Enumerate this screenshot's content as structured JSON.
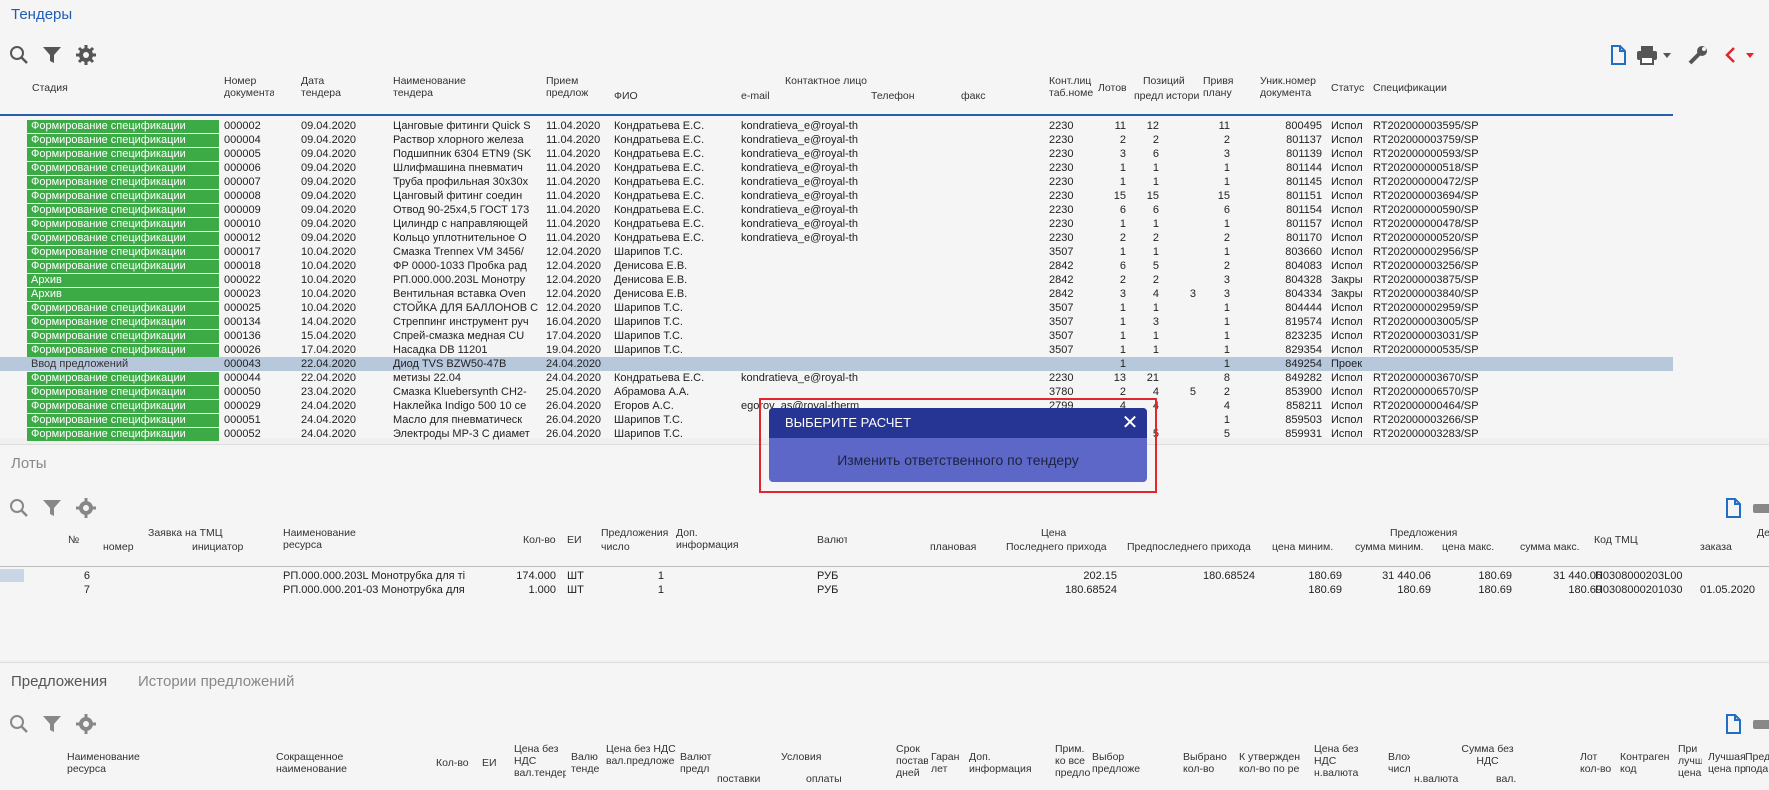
{
  "tenders": {
    "title": "Тендеры",
    "columns": {
      "stage": "Стадия",
      "doc_no": "Номер документа",
      "date": "Дата тендера",
      "name": "Наименование тендера",
      "accept": "Прием предлож",
      "contact": "Контактное лицо",
      "fio": "ФИО",
      "email": "e-mail",
      "phone": "Телефон",
      "fax": "факс",
      "cont_tab": "Конт.лиц таб.номе",
      "lots": "Лотов",
      "positions": "Позиций",
      "pos_sub1": "предл",
      "pos_sub2": "истори",
      "plan": "Привя плану",
      "uniq": "Уник.номер документа",
      "status": "Статус",
      "spec": "Спецификации"
    },
    "rows": [
      {
        "stage": "Формирование спецификации",
        "no": "000002",
        "date": "09.04.2020",
        "name": "Цанговые фитинги Quick S",
        "acc": "11.04.2020",
        "fio": "Кондратьева Е.С.",
        "email": "kondratieva_e@royal-th",
        "tab": "2230",
        "lots": "11",
        "pos": "12",
        "hist": "",
        "plan": "11",
        "uniq": "800495",
        "status": "Испол",
        "spec": "RT202000003595/SP",
        "kind": "green"
      },
      {
        "stage": "Формирование спецификации",
        "no": "000004",
        "date": "09.04.2020",
        "name": "Раствор хлорного железа",
        "acc": "11.04.2020",
        "fio": "Кондратьева Е.С.",
        "email": "kondratieva_e@royal-th",
        "tab": "2230",
        "lots": "2",
        "pos": "2",
        "hist": "",
        "plan": "2",
        "uniq": "801137",
        "status": "Испол",
        "spec": "RT202000003759/SP",
        "kind": "green"
      },
      {
        "stage": "Формирование спецификации",
        "no": "000005",
        "date": "09.04.2020",
        "name": "Подшипник 6304 ETN9 (SK",
        "acc": "11.04.2020",
        "fio": "Кондратьева Е.С.",
        "email": "kondratieva_e@royal-th",
        "tab": "2230",
        "lots": "3",
        "pos": "6",
        "hist": "",
        "plan": "3",
        "uniq": "801139",
        "status": "Испол",
        "spec": "RT202000000593/SP",
        "kind": "green"
      },
      {
        "stage": "Формирование спецификации",
        "no": "000006",
        "date": "09.04.2020",
        "name": "Шлифмашина пневматич",
        "acc": "11.04.2020",
        "fio": "Кондратьева Е.С.",
        "email": "kondratieva_e@royal-th",
        "tab": "2230",
        "lots": "1",
        "pos": "1",
        "hist": "",
        "plan": "1",
        "uniq": "801144",
        "status": "Испол",
        "spec": "RT202000000518/SP",
        "kind": "green"
      },
      {
        "stage": "Формирование спецификации",
        "no": "000007",
        "date": "09.04.2020",
        "name": "Труба профильная 30х30х",
        "acc": "11.04.2020",
        "fio": "Кондратьева Е.С.",
        "email": "kondratieva_e@royal-th",
        "tab": "2230",
        "lots": "1",
        "pos": "1",
        "hist": "",
        "plan": "1",
        "uniq": "801145",
        "status": "Испол",
        "spec": "RT202000000472/SP",
        "kind": "green"
      },
      {
        "stage": "Формирование спецификации",
        "no": "000008",
        "date": "09.04.2020",
        "name": "Цанговый фитинг соедин",
        "acc": "11.04.2020",
        "fio": "Кондратьева Е.С.",
        "email": "kondratieva_e@royal-th",
        "tab": "2230",
        "lots": "15",
        "pos": "15",
        "hist": "",
        "plan": "15",
        "uniq": "801151",
        "status": "Испол",
        "spec": "RT202000003694/SP",
        "kind": "green"
      },
      {
        "stage": "Формирование спецификации",
        "no": "000009",
        "date": "09.04.2020",
        "name": "Отвод 90-25х4,5 ГОСТ 173",
        "acc": "11.04.2020",
        "fio": "Кондратьева Е.С.",
        "email": "kondratieva_e@royal-th",
        "tab": "2230",
        "lots": "6",
        "pos": "6",
        "hist": "",
        "plan": "6",
        "uniq": "801154",
        "status": "Испол",
        "spec": "RT202000000590/SP",
        "kind": "green"
      },
      {
        "stage": "Формирование спецификации",
        "no": "000010",
        "date": "09.04.2020",
        "name": "Цилиндр с направляющей",
        "acc": "11.04.2020",
        "fio": "Кондратьева Е.С.",
        "email": "kondratieva_e@royal-th",
        "tab": "2230",
        "lots": "1",
        "pos": "1",
        "hist": "",
        "plan": "1",
        "uniq": "801157",
        "status": "Испол",
        "spec": "RT202000000478/SP",
        "kind": "green"
      },
      {
        "stage": "Формирование спецификации",
        "no": "000012",
        "date": "09.04.2020",
        "name": "Кольцо уплотнительное О",
        "acc": "11.04.2020",
        "fio": "Кондратьева Е.С.",
        "email": "kondratieva_e@royal-th",
        "tab": "2230",
        "lots": "2",
        "pos": "2",
        "hist": "",
        "plan": "2",
        "uniq": "801170",
        "status": "Испол",
        "spec": "RT202000000520/SP",
        "kind": "green"
      },
      {
        "stage": "Формирование спецификации",
        "no": "000017",
        "date": "10.04.2020",
        "name": "Смазка Trennex VM 3456/",
        "acc": "12.04.2020",
        "fio": "Шарипов Т.С.",
        "email": "",
        "tab": "3507",
        "lots": "1",
        "pos": "1",
        "hist": "",
        "plan": "1",
        "uniq": "803660",
        "status": "Испол",
        "spec": "RT202000002956/SP",
        "kind": "green"
      },
      {
        "stage": "Формирование спецификации",
        "no": "000018",
        "date": "10.04.2020",
        "name": "ФР 0000-1033 Пробка рад",
        "acc": "12.04.2020",
        "fio": "Денисова Е.В.",
        "email": "",
        "tab": "2842",
        "lots": "6",
        "pos": "5",
        "hist": "",
        "plan": "2",
        "uniq": "804083",
        "status": "Испол",
        "spec": "RT202000003256/SP",
        "kind": "green"
      },
      {
        "stage": "Архив",
        "no": "000022",
        "date": "10.04.2020",
        "name": "РП.000.000.203L Монотру",
        "acc": "12.04.2020",
        "fio": "Денисова Е.В.",
        "email": "",
        "tab": "2842",
        "lots": "2",
        "pos": "2",
        "hist": "",
        "plan": "3",
        "uniq": "804328",
        "status": "Закры",
        "spec": "RT202000003875/SP",
        "kind": "green"
      },
      {
        "stage": "Архив",
        "no": "000023",
        "date": "10.04.2020",
        "name": "Вентильная вставка Oven",
        "acc": "12.04.2020",
        "fio": "Денисова Е.В.",
        "email": "",
        "tab": "2842",
        "lots": "3",
        "pos": "4",
        "hist": "3",
        "plan": "3",
        "uniq": "804334",
        "status": "Закры",
        "spec": "RT202000003840/SP",
        "kind": "green"
      },
      {
        "stage": "Формирование спецификации",
        "no": "000025",
        "date": "10.04.2020",
        "name": "СТОЙКА ДЛЯ БАЛЛОНОВ С",
        "acc": "12.04.2020",
        "fio": "Шарипов Т.С.",
        "email": "",
        "tab": "3507",
        "lots": "1",
        "pos": "1",
        "hist": "",
        "plan": "1",
        "uniq": "804444",
        "status": "Испол",
        "spec": "RT202000002959/SP",
        "kind": "green"
      },
      {
        "stage": "Формирование спецификации",
        "no": "000134",
        "date": "14.04.2020",
        "name": "Стреппинг инструмент руч",
        "acc": "16.04.2020",
        "fio": "Шарипов Т.С.",
        "email": "",
        "tab": "3507",
        "lots": "1",
        "pos": "3",
        "hist": "",
        "plan": "1",
        "uniq": "819574",
        "status": "Испол",
        "spec": "RT202000003005/SP",
        "kind": "green"
      },
      {
        "stage": "Формирование спецификации",
        "no": "000136",
        "date": "15.04.2020",
        "name": "Спрей-смазка медная CU",
        "acc": "17.04.2020",
        "fio": "Шарипов Т.С.",
        "email": "",
        "tab": "3507",
        "lots": "1",
        "pos": "1",
        "hist": "",
        "plan": "1",
        "uniq": "823235",
        "status": "Испол",
        "spec": "RT202000003031/SP",
        "kind": "green"
      },
      {
        "stage": "Формирование спецификации",
        "no": "000026",
        "date": "17.04.2020",
        "name": "Насадка DB 11201",
        "acc": "19.04.2020",
        "fio": "Шарипов Т.С.",
        "email": "",
        "tab": "3507",
        "lots": "1",
        "pos": "1",
        "hist": "",
        "plan": "1",
        "uniq": "829354",
        "status": "Испол",
        "spec": "RT202000000535/SP",
        "kind": "green"
      },
      {
        "stage": "Ввод предложений",
        "no": "000043",
        "date": "22.04.2020",
        "name": "Диод TVS BZW50-47B",
        "acc": "24.04.2020",
        "fio": "",
        "email": "",
        "tab": "",
        "lots": "1",
        "pos": "",
        "hist": "",
        "plan": "1",
        "uniq": "849254",
        "status": "Проек",
        "spec": "",
        "kind": "selected"
      },
      {
        "stage": "Формирование спецификации",
        "no": "000044",
        "date": "22.04.2020",
        "name": "метизы 22.04",
        "acc": "24.04.2020",
        "fio": "Кондратьева Е.С.",
        "email": "kondratieva_e@royal-th",
        "tab": "2230",
        "lots": "13",
        "pos": "21",
        "hist": "",
        "plan": "8",
        "uniq": "849282",
        "status": "Испол",
        "spec": "RT202000003670/SP",
        "kind": "green"
      },
      {
        "stage": "Формирование спецификации",
        "no": "000050",
        "date": "23.04.2020",
        "name": "Смазка Kluebersynth CH2-",
        "acc": "25.04.2020",
        "fio": "Абрамова А.А.",
        "email": "",
        "tab": "3780",
        "lots": "2",
        "pos": "4",
        "hist": "5",
        "plan": "2",
        "uniq": "853900",
        "status": "Испол",
        "spec": "RT202000006570/SP",
        "kind": "green"
      },
      {
        "stage": "Формирование спецификации",
        "no": "000029",
        "date": "24.04.2020",
        "name": "Наклейка Indigo 500 10 се",
        "acc": "26.04.2020",
        "fio": "Егоров А.С.",
        "email": "egorov_as@royal-therm",
        "tab": "2799",
        "lots": "4",
        "pos": "4",
        "hist": "",
        "plan": "4",
        "uniq": "858211",
        "status": "Испол",
        "spec": "RT202000000464/SP",
        "kind": "green"
      },
      {
        "stage": "Формирование спецификации",
        "no": "000051",
        "date": "24.04.2020",
        "name": "Масло для пневматическ",
        "acc": "26.04.2020",
        "fio": "Шарипов Т.С.",
        "email": "",
        "tab": "",
        "lots": "",
        "pos": "",
        "hist": "",
        "plan": "1",
        "uniq": "859503",
        "status": "Испол",
        "spec": "RT202000003266/SP",
        "kind": "green"
      },
      {
        "stage": "Формирование спецификации",
        "no": "000052",
        "date": "24.04.2020",
        "name": "Электроды МР-3 С диамет",
        "acc": "26.04.2020",
        "fio": "Шарипов Т.С.",
        "email": "",
        "tab": "",
        "lots": "",
        "pos": "5",
        "hist": "",
        "plan": "5",
        "uniq": "859931",
        "status": "Испол",
        "spec": "RT202000003283/SP",
        "kind": "green"
      }
    ]
  },
  "lots": {
    "title": "Лоты",
    "columns": {
      "no": "№",
      "request": "Заявка на ТМЦ",
      "req_no": "номер",
      "req_init": "инициатор",
      "name": "Наименование ресурса",
      "qty": "Кол-во",
      "unit": "ЕИ",
      "offers": "Предложения",
      "offers_num": "число",
      "add_info": "Доп. информация",
      "currency": "Валют",
      "price": "Цена",
      "planned": "плановая",
      "last_in": "Последнего прихода",
      "prev_in": "Предпоследнего прихода",
      "offers2": "Предложения",
      "price_min": "цена миним.",
      "sum_min": "сумма миним.",
      "price_max": "цена макс.",
      "sum_max": "сумма макс.",
      "code": "Код ТМЦ",
      "de": "Де",
      "order": "заказа"
    },
    "rows": [
      {
        "no": "6",
        "name": "РП.000.000.203L Монотрубка для ті",
        "qty": "174.000",
        "unit": "ШТ",
        "offers": "1",
        "cur": "РУБ",
        "last": "202.15",
        "prev": "180.68524",
        "pmin": "180.69",
        "smin": "31 440.06",
        "pmax": "180.69",
        "smax": "31 440.06",
        "code": "П0308000203L00",
        "date": ""
      },
      {
        "no": "7",
        "name": "РП.000.000.201-03 Монотрубка для",
        "qty": "1.000",
        "unit": "ШТ",
        "offers": "1",
        "cur": "РУБ",
        "last": "180.68524",
        "prev": "",
        "pmin": "180.69",
        "smin": "180.69",
        "pmax": "180.69",
        "smax": "180.69",
        "code": "П0308000201030",
        "date": "01.05.2020"
      }
    ]
  },
  "offers": {
    "tab1": "Предложения",
    "tab2": "Истории предложений",
    "columns": {
      "name": "Наименование ресурса",
      "short": "Сокращенное наименование",
      "qty": "Кол-во",
      "unit": "ЕИ",
      "price": "Цена без НДС вал.тендер",
      "cur1": "Валю тенде",
      "price2": "Цена без НДС вал.предложе",
      "cur2": "Валют предл",
      "conds": "Условия",
      "deliv": "поставки",
      "pay": "оплаты",
      "term": "Срок постав дней",
      "guar": "Гаран лет",
      "info": "Доп. информация",
      "note": "Прим. ко все предлож",
      "choose": "Выбор предложе",
      "chosen": "Выбрано кол-во",
      "approve": "К утвержден кол-во по ре",
      "price3": "Цена без НДС н.валюта",
      "attach": "Влож числ",
      "sum": "Сумма без НДС",
      "sum_cur": "н.валюта",
      "sum_val": "вал.",
      "lot": "Лот кол-во",
      "contr": "Контраген код",
      "best": "При лучш цена",
      "best2": "Лучшая цена пр",
      "pred": "Пред пода"
    }
  },
  "modal": {
    "title": "ВЫБЕРИТЕ РАСЧЕТ",
    "item": "Изменить ответственного по тендеру"
  }
}
